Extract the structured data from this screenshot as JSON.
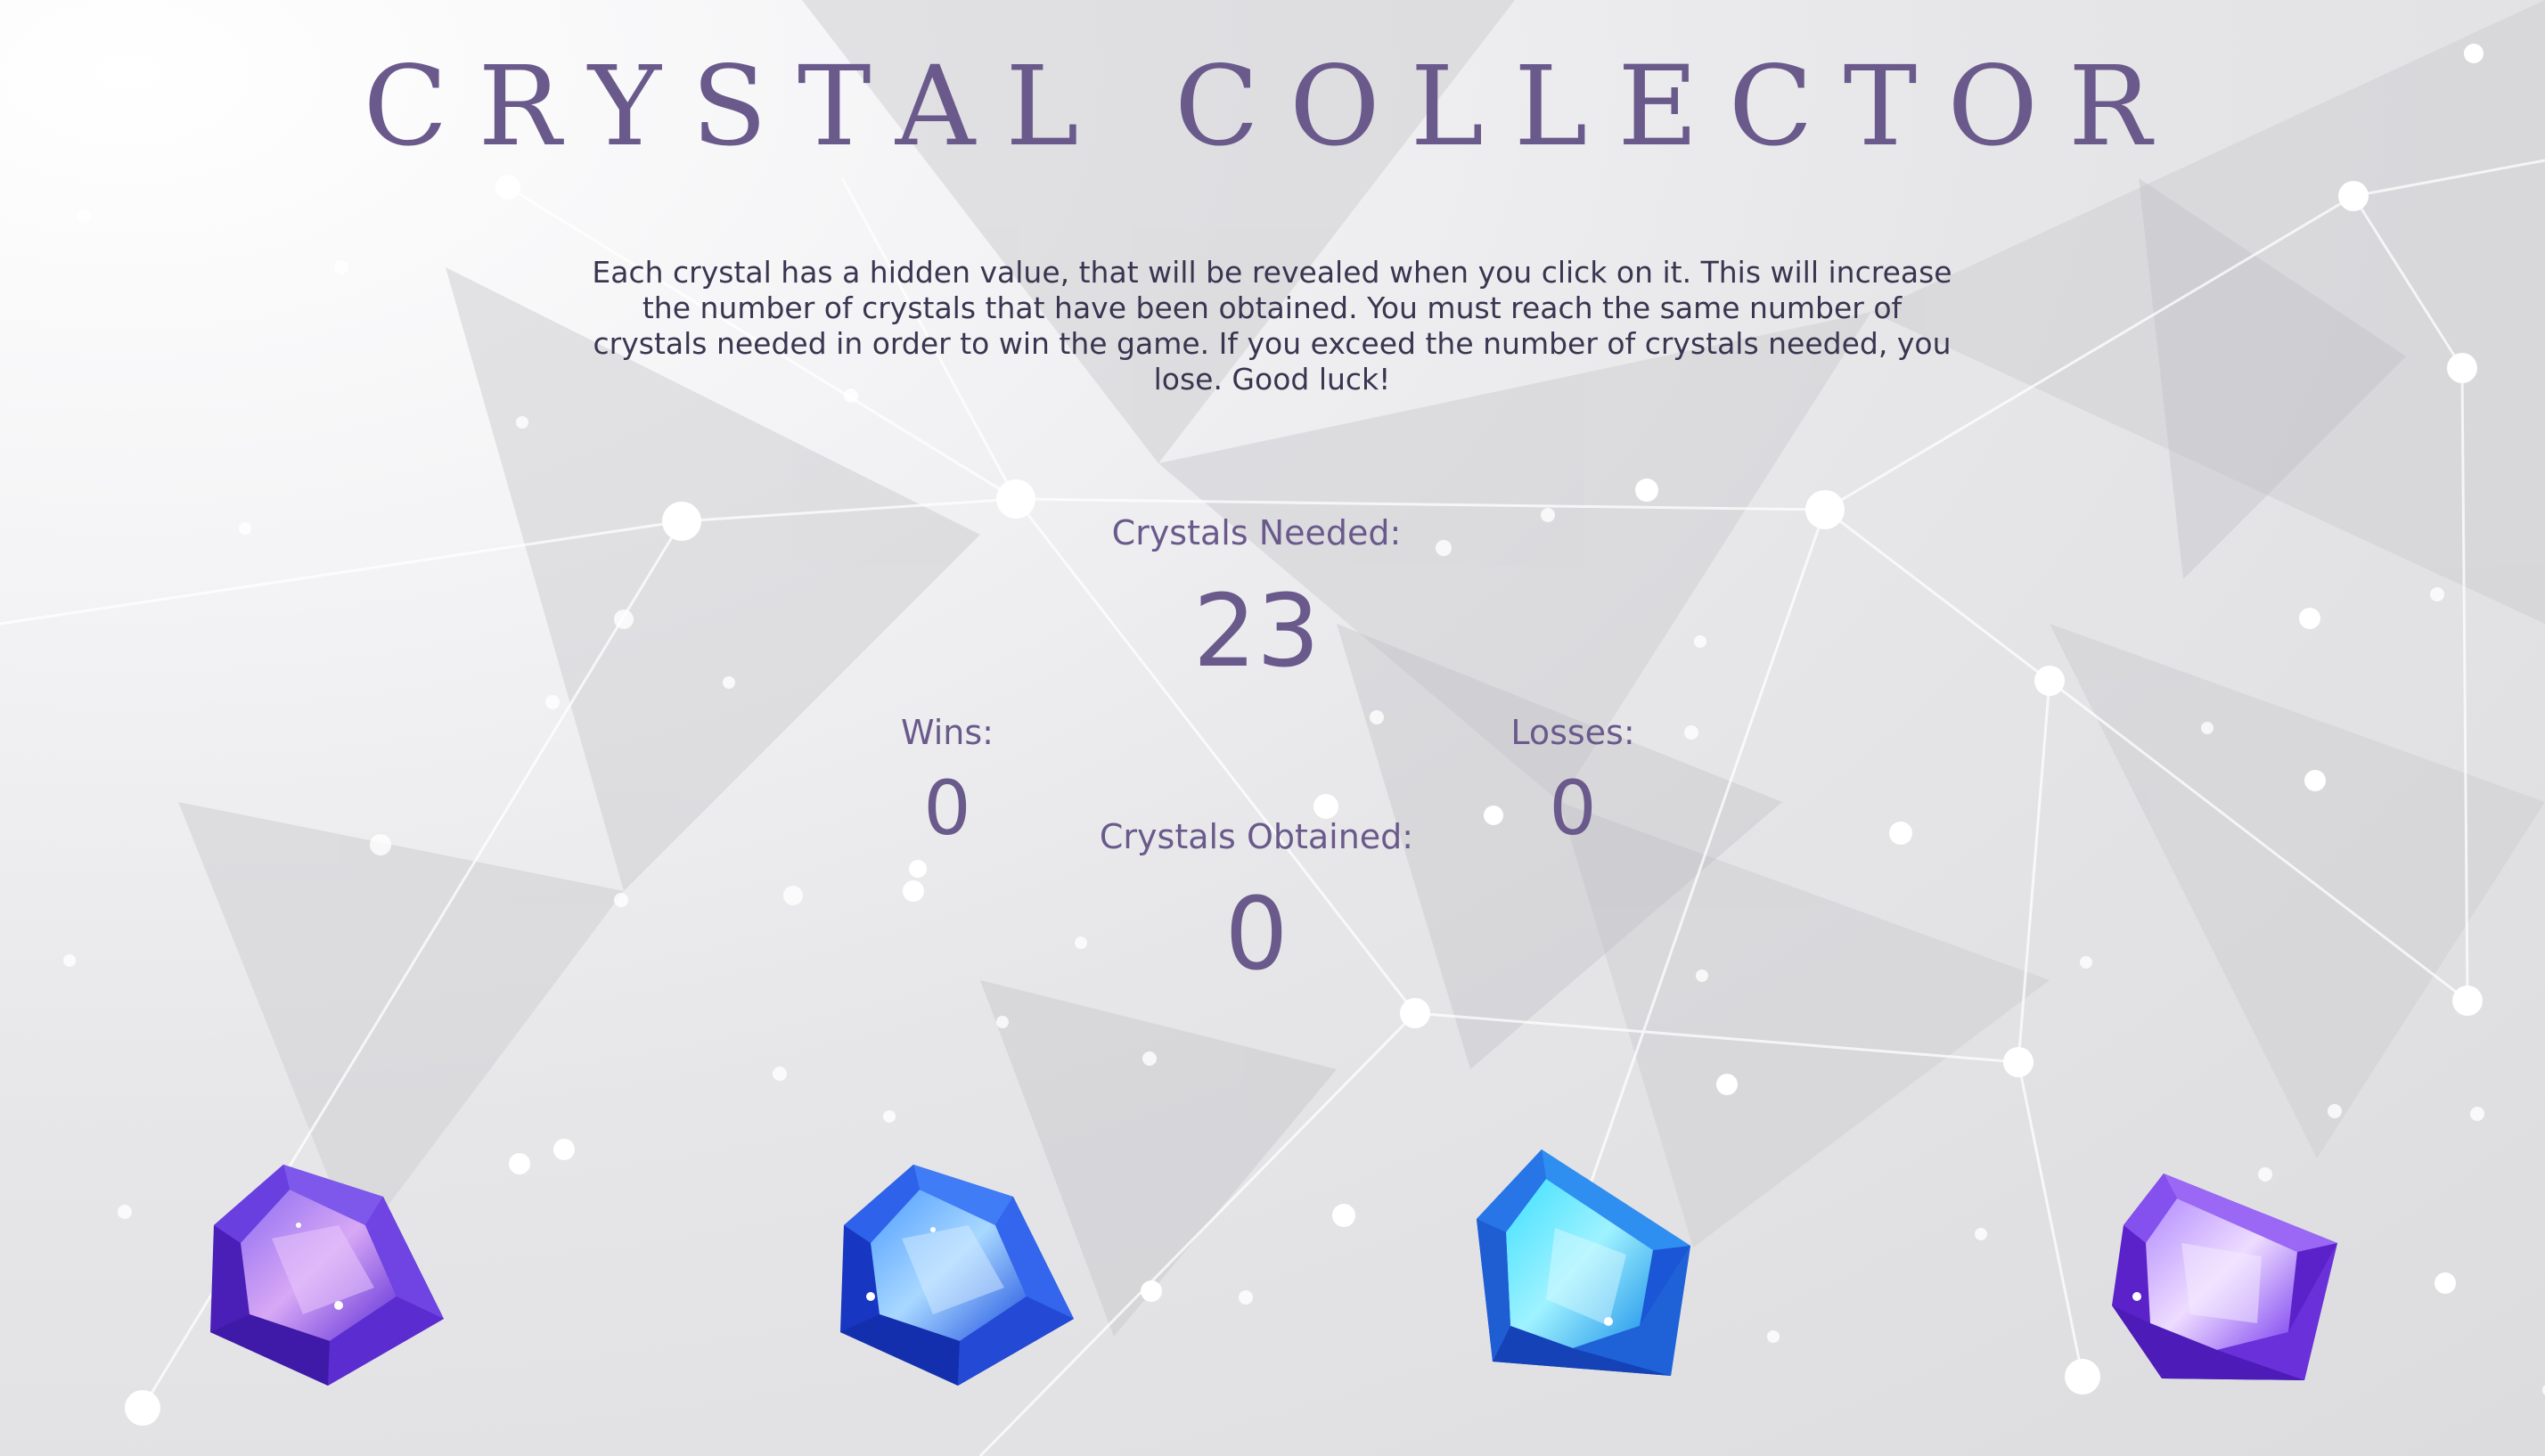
{
  "game": {
    "title": "CRYSTAL COLLECTOR",
    "instructions": "Each crystal has a hidden value, that will be revealed when you click on it. This will increase the number of crystals that have been obtained. You must reach the same number of crystals needed in order to win the game. If you exceed the number of crystals needed, you lose. Good luck!"
  },
  "stats": {
    "needed_label": "Crystals Needed:",
    "needed_value": "23",
    "wins_label": "Wins:",
    "wins_value": "0",
    "losses_label": "Losses:",
    "losses_value": "0",
    "obtained_label": "Crystals Obtained:",
    "obtained_value": "0"
  },
  "crystals": [
    {
      "icon": "purple-crystal-icon"
    },
    {
      "icon": "blue-crystal-icon"
    },
    {
      "icon": "cyan-crystal-icon"
    },
    {
      "icon": "violet-crystal-icon"
    }
  ],
  "colors": {
    "accent": "#6a5a8c",
    "text": "#3a3550"
  }
}
